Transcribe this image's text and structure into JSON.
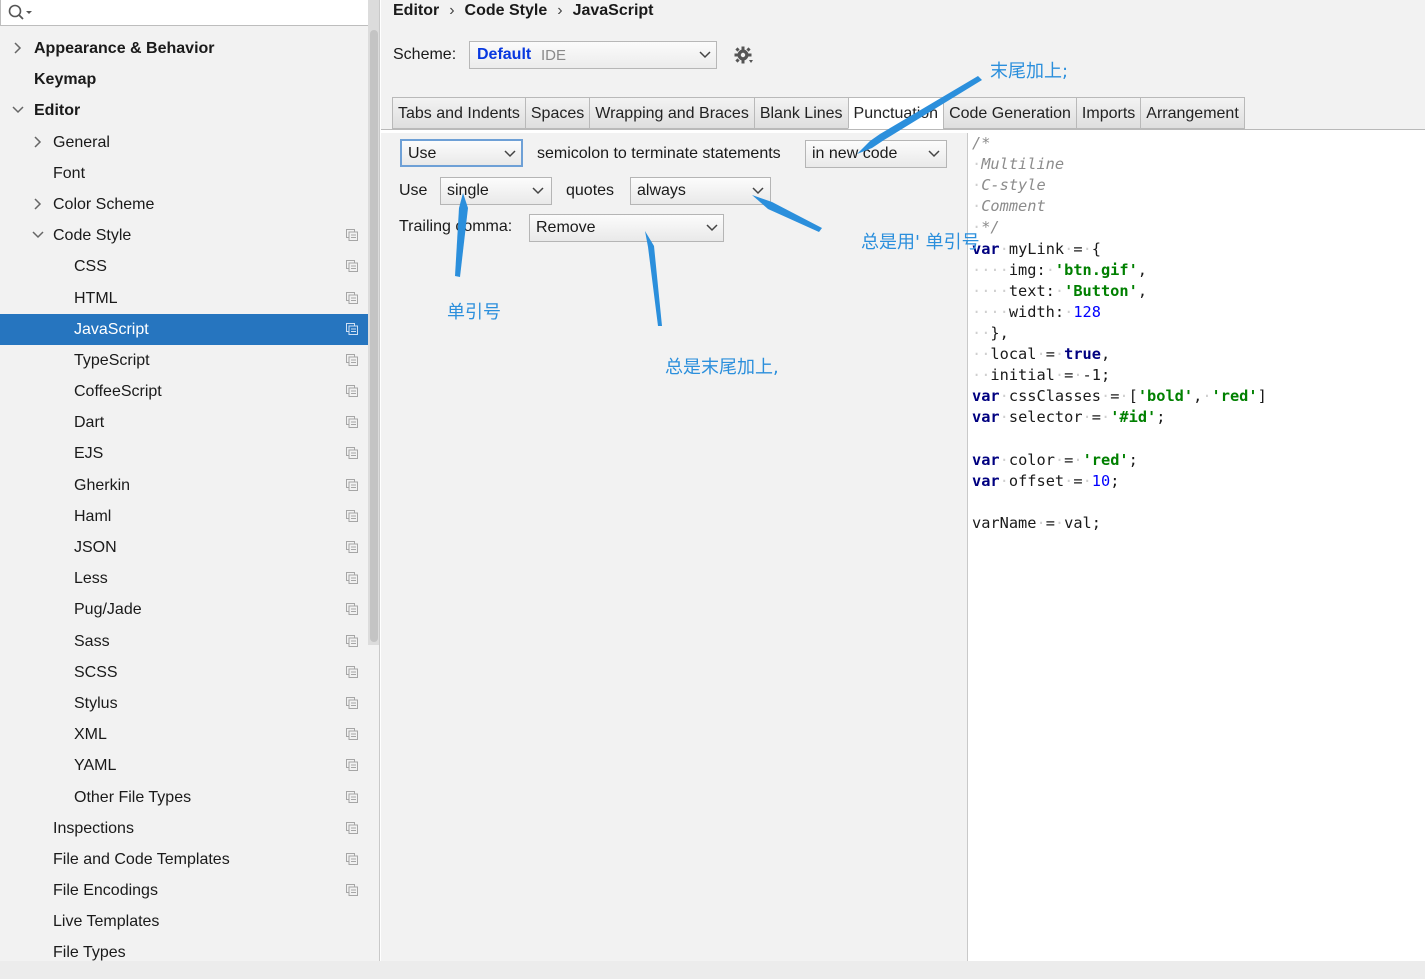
{
  "breadcrumb": [
    "Editor",
    "Code Style",
    "JavaScript"
  ],
  "search": {
    "placeholder": ""
  },
  "sidebar": {
    "items": [
      {
        "label": "Appearance & Behavior",
        "level": 0,
        "expander": "collapsed",
        "bold": true
      },
      {
        "label": "Keymap",
        "level": 0,
        "expander": "none",
        "bold": true
      },
      {
        "label": "Editor",
        "level": 0,
        "expander": "expanded",
        "bold": true
      },
      {
        "label": "General",
        "level": 1,
        "expander": "collapsed"
      },
      {
        "label": "Font",
        "level": 1,
        "expander": "none"
      },
      {
        "label": "Color Scheme",
        "level": 1,
        "expander": "collapsed"
      },
      {
        "label": "Code Style",
        "level": 1,
        "expander": "expanded",
        "copy_icon": true
      },
      {
        "label": "CSS",
        "level": 2,
        "copy_icon": true
      },
      {
        "label": "HTML",
        "level": 2,
        "copy_icon": true
      },
      {
        "label": "JavaScript",
        "level": 2,
        "copy_icon": true,
        "selected": true
      },
      {
        "label": "TypeScript",
        "level": 2,
        "copy_icon": true
      },
      {
        "label": "CoffeeScript",
        "level": 2,
        "copy_icon": true
      },
      {
        "label": "Dart",
        "level": 2,
        "copy_icon": true
      },
      {
        "label": "EJS",
        "level": 2,
        "copy_icon": true
      },
      {
        "label": "Gherkin",
        "level": 2,
        "copy_icon": true
      },
      {
        "label": "Haml",
        "level": 2,
        "copy_icon": true
      },
      {
        "label": "JSON",
        "level": 2,
        "copy_icon": true
      },
      {
        "label": "Less",
        "level": 2,
        "copy_icon": true
      },
      {
        "label": "Pug/Jade",
        "level": 2,
        "copy_icon": true
      },
      {
        "label": "Sass",
        "level": 2,
        "copy_icon": true
      },
      {
        "label": "SCSS",
        "level": 2,
        "copy_icon": true
      },
      {
        "label": "Stylus",
        "level": 2,
        "copy_icon": true
      },
      {
        "label": "XML",
        "level": 2,
        "copy_icon": true
      },
      {
        "label": "YAML",
        "level": 2,
        "copy_icon": true
      },
      {
        "label": "Other File Types",
        "level": 2,
        "copy_icon": true
      },
      {
        "label": "Inspections",
        "level": 1,
        "copy_icon": true
      },
      {
        "label": "File and Code Templates",
        "level": 1,
        "copy_icon": true
      },
      {
        "label": "File Encodings",
        "level": 1,
        "copy_icon": true
      },
      {
        "label": "Live Templates",
        "level": 1
      },
      {
        "label": "File Types",
        "level": 1
      }
    ]
  },
  "scheme": {
    "label": "Scheme:",
    "name": "Default",
    "scope": "IDE"
  },
  "tabs": [
    {
      "label": "Tabs and Indents"
    },
    {
      "label": "Spaces"
    },
    {
      "label": "Wrapping and Braces"
    },
    {
      "label": "Blank Lines"
    },
    {
      "label": "Punctuation",
      "active": true
    },
    {
      "label": "Code Generation"
    },
    {
      "label": "Imports"
    },
    {
      "label": "Arrangement"
    }
  ],
  "punctuation": {
    "semicolon_mode": "Use",
    "semicolon_text": "semicolon to terminate statements",
    "semicolon_scope": "in new code",
    "use_label": "Use",
    "quote_kind": "single",
    "quotes_label": "quotes",
    "quote_when": "always",
    "trailing_label": "Trailing comma:",
    "trailing_value": "Remove"
  },
  "preview_lines": [
    [
      [
        "cmt",
        "/*"
      ]
    ],
    [
      [
        "ws",
        "·"
      ],
      [
        "cmt",
        "Multiline"
      ]
    ],
    [
      [
        "ws",
        "·"
      ],
      [
        "cmt",
        "C-style"
      ]
    ],
    [
      [
        "ws",
        "·"
      ],
      [
        "cmt",
        "Comment"
      ]
    ],
    [
      [
        "ws",
        "·"
      ],
      [
        "cmt",
        "*/"
      ]
    ],
    [
      [
        "kw",
        "var"
      ],
      [
        "ws",
        "·"
      ],
      [
        "p",
        "myLink"
      ],
      [
        "ws",
        "·"
      ],
      [
        "p",
        "="
      ],
      [
        "ws",
        "·"
      ],
      [
        "p",
        "{"
      ]
    ],
    [
      [
        "ws",
        "····"
      ],
      [
        "p",
        "img:"
      ],
      [
        "ws",
        "·"
      ],
      [
        "str",
        "'btn.gif'"
      ],
      [
        "p",
        ","
      ]
    ],
    [
      [
        "ws",
        "····"
      ],
      [
        "p",
        "text:"
      ],
      [
        "ws",
        "·"
      ],
      [
        "str",
        "'Button'"
      ],
      [
        "p",
        ","
      ]
    ],
    [
      [
        "ws",
        "····"
      ],
      [
        "p",
        "width:"
      ],
      [
        "ws",
        "·"
      ],
      [
        "num",
        "128"
      ]
    ],
    [
      [
        "ws",
        "··"
      ],
      [
        "p",
        "},"
      ]
    ],
    [
      [
        "ws",
        "··"
      ],
      [
        "p",
        "local"
      ],
      [
        "ws",
        "·"
      ],
      [
        "p",
        "="
      ],
      [
        "ws",
        "·"
      ],
      [
        "kw",
        "true"
      ],
      [
        "p",
        ","
      ]
    ],
    [
      [
        "ws",
        "··"
      ],
      [
        "p",
        "initial"
      ],
      [
        "ws",
        "·"
      ],
      [
        "p",
        "="
      ],
      [
        "ws",
        "·"
      ],
      [
        "p",
        "-1;"
      ]
    ],
    [
      [
        "kw",
        "var"
      ],
      [
        "ws",
        "·"
      ],
      [
        "p",
        "cssClasses"
      ],
      [
        "ws",
        "·"
      ],
      [
        "p",
        "="
      ],
      [
        "ws",
        "·"
      ],
      [
        "p",
        "["
      ],
      [
        "str",
        "'bold'"
      ],
      [
        "p",
        ","
      ],
      [
        "ws",
        "·"
      ],
      [
        "str",
        "'red'"
      ],
      [
        "p",
        "]"
      ]
    ],
    [
      [
        "kw",
        "var"
      ],
      [
        "ws",
        "·"
      ],
      [
        "p",
        "selector"
      ],
      [
        "ws",
        "·"
      ],
      [
        "p",
        "="
      ],
      [
        "ws",
        "·"
      ],
      [
        "str",
        "'#id'"
      ],
      [
        "p",
        ";"
      ]
    ],
    [],
    [
      [
        "kw",
        "var"
      ],
      [
        "ws",
        "·"
      ],
      [
        "p",
        "color"
      ],
      [
        "ws",
        "·"
      ],
      [
        "p",
        "="
      ],
      [
        "ws",
        "·"
      ],
      [
        "str",
        "'red'"
      ],
      [
        "p",
        ";"
      ]
    ],
    [
      [
        "kw",
        "var"
      ],
      [
        "ws",
        "·"
      ],
      [
        "p",
        "offset"
      ],
      [
        "ws",
        "·"
      ],
      [
        "p",
        "="
      ],
      [
        "ws",
        "·"
      ],
      [
        "num",
        "10"
      ],
      [
        "p",
        ";"
      ]
    ],
    [],
    [
      [
        "p",
        "varName"
      ],
      [
        "ws",
        "·"
      ],
      [
        "p",
        "="
      ],
      [
        "ws",
        "·"
      ],
      [
        "p",
        "val;"
      ]
    ]
  ],
  "annotations": {
    "end_semicolon": "末尾加上;",
    "always_single": "总是用' 单引号",
    "single_quote": "单引号",
    "always_trailing": "总是末尾加上,"
  },
  "colors": {
    "accent": "#2675bf",
    "annotation": "#2b8fdc",
    "scheme_name": "#0838e0"
  }
}
